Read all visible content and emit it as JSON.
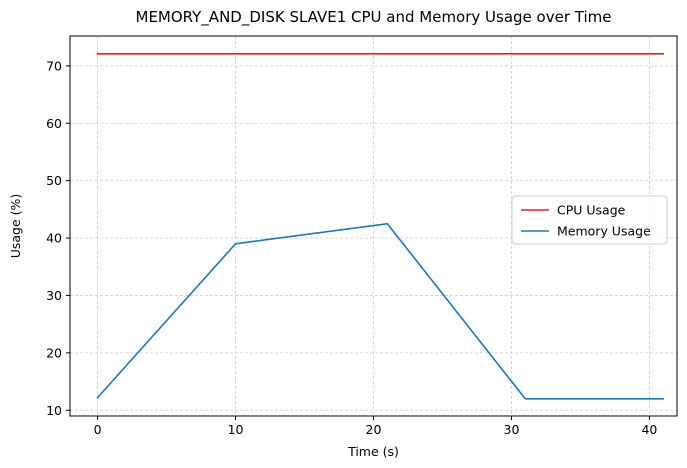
{
  "chart_data": {
    "type": "line",
    "title": "MEMORY_AND_DISK SLAVE1 CPU and Memory Usage over Time",
    "xlabel": "Time (s)",
    "ylabel": "Usage (%)",
    "xlim": [
      -2,
      42
    ],
    "ylim": [
      9,
      75.2
    ],
    "xticks": [
      0,
      10,
      20,
      30,
      40
    ],
    "yticks": [
      10,
      20,
      30,
      40,
      50,
      60,
      70
    ],
    "grid": true,
    "legend_position": "center-right",
    "series": [
      {
        "name": "CPU Usage",
        "color": "#d62728",
        "x": [
          0,
          41
        ],
        "y": [
          72.1,
          72.1
        ]
      },
      {
        "name": "Memory Usage",
        "color": "#1f77b4",
        "x": [
          0,
          10,
          21,
          31,
          41
        ],
        "y": [
          12.2,
          39,
          42.5,
          12,
          12
        ]
      }
    ]
  }
}
